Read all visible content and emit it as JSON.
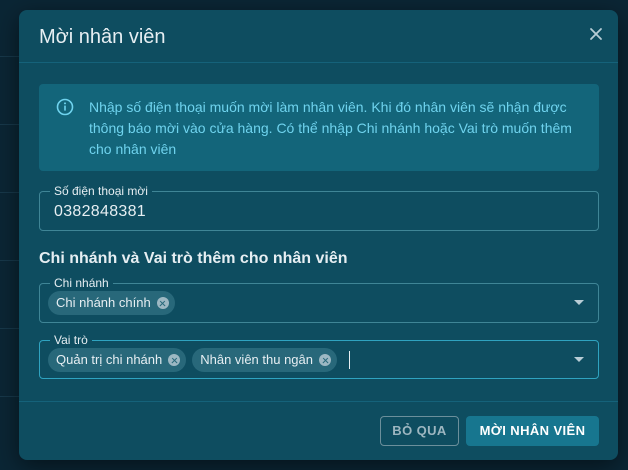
{
  "dialog": {
    "title": "Mời nhân viên",
    "info_text": "Nhập số điện thoại muốn mời làm nhân viên. Khi đó nhân viên sẽ nhận được thông báo mời vào cửa hàng. Có thể nhập Chi nhánh hoặc Vai trò muốn thêm cho nhân viên",
    "phone": {
      "label": "Số điện thoại mời",
      "value": "0382848381"
    },
    "section_title": "Chi nhánh và Vai trò thêm cho nhân viên",
    "branch": {
      "label": "Chi nhánh",
      "chips": [
        "Chi nhánh chính"
      ]
    },
    "role": {
      "label": "Vai trò",
      "chips": [
        "Quản trị chi nhánh",
        "Nhân viên thu ngân"
      ]
    },
    "buttons": {
      "skip": "BỎ QUA",
      "invite": "MỜI NHÂN VIÊN"
    }
  },
  "colors": {
    "dialog_bg": "#0e4d60",
    "alert_bg": "#13657a",
    "alert_text": "#6fd3ee",
    "primary_button": "#17768f"
  }
}
